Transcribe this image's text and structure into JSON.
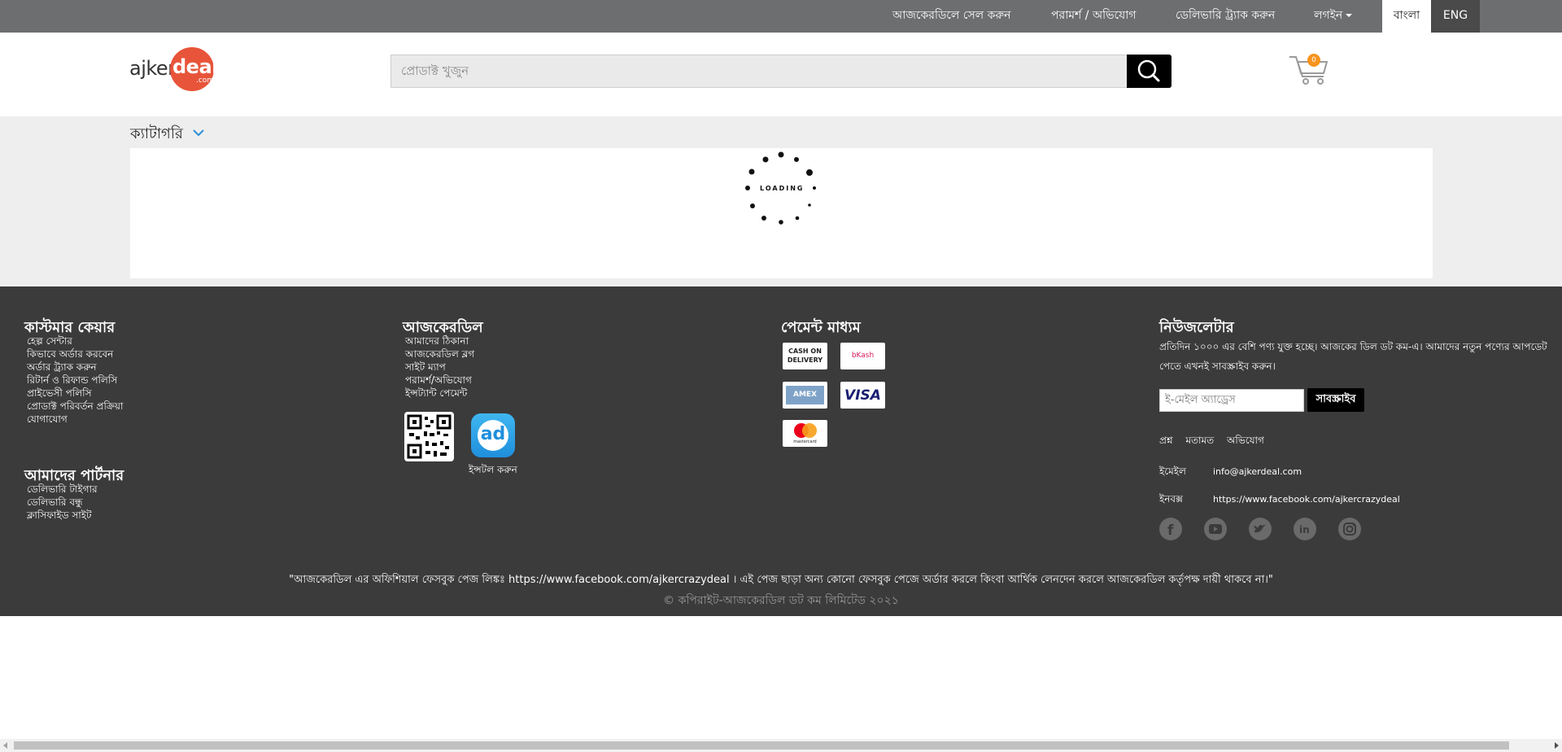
{
  "topbar": {
    "sell": "আজকেরডিলে সেল করুন",
    "feedback": "পরামর্শ / অভিযোগ",
    "track": "ডেলিভারি ট্র্যাক করুন",
    "login": "লগইন",
    "lang_bn": "বাংলা",
    "lang_en": "ENG"
  },
  "header": {
    "logo_ajker": "ajker",
    "logo_deal": "deal",
    "logo_com": ".com",
    "search_placeholder": "প্রোডাক্ট খুজুন",
    "cart_count": "0"
  },
  "category": {
    "label": "ক্যাটাগরি",
    "loading": "LOADING"
  },
  "footer": {
    "customer_care": {
      "title": "কাস্টমার কেয়ার",
      "items": [
        "হেল্প সেন্টার",
        "কিভাবে অর্ডার করবেন",
        "অর্ডার ট্র্যাক করুন",
        "রিটার্ন ও রিফান্ড পলিসি",
        "প্রাইভেসী পলিসি",
        "প্রোডাক্ট পরিবর্তন প্রক্রিয়া",
        "যোগাযোগ"
      ]
    },
    "partners": {
      "title": "আমাদের পার্টনার",
      "items": [
        "ডেলিভারি টাইগার",
        "ডেলিভারি বন্ধু",
        "ক্লাসিফাইড সাইট"
      ]
    },
    "ajkerdeal": {
      "title": "আজকেরডিল",
      "items": [
        "আমাদের ঠিকানা",
        "আজকেরডিল ব্লগ",
        "সাইট ম্যাপ",
        "পরামর্শ/অভিযোগ",
        "ইন্সট্যান্ট পেমেন্ট"
      ],
      "app_caption": "ইন্সটল করুন",
      "app_icon_text": "ad"
    },
    "payment": {
      "title": "পেমেন্ট মাধ্যম",
      "cod": "CASH ON DELIVERY",
      "bkash": "bKash",
      "amex": "AMEX",
      "visa": "VISA",
      "mastercard": "mastercard"
    },
    "newsletter": {
      "title": "নিউজলেটার",
      "description": "প্রতিদিন ১০০০ এর বেশি পণ্য যুক্ত হচ্ছে। আজকের ডিল ডট কম-এ। আমাদের নতুন পণ্যের আপডেট পেতে এখনই সাবস্ক্রাইব করুন।",
      "email_placeholder": "ই-মেইল অ্যাড্রেস",
      "subscribe": "সাবস্ক্রাইব",
      "links": [
        "প্রশ্ন",
        "মতামত",
        "অভিযোগ"
      ],
      "email_label": "ইমেইল",
      "email_value": "info@ajkerdeal.com",
      "inbox_label": "ইনবক্স",
      "inbox_value": "https://www.facebook.com/ajkercrazydeal"
    },
    "disclaimer": "\"আজকেরডিল এর অফিশিয়াল ফেসবুক পেজ লিঙ্কঃ https://www.facebook.com/ajkercrazydeal । এই পেজ ছাড়া অন্য কোনো ফেসবুক পেজে অর্ডার করলে কিংবা আর্থিক লেনদেন করলে আজকেরডিল কর্তৃপক্ষ দায়ী থাকবে না।\"",
    "copyright": "© কপিরাইট-আজকেরডিল ডট কম লিমিটেড ২০২১"
  },
  "colors": {
    "topbar": "#6d6e70",
    "footer": "#3b3b3c",
    "accent_orange": "#e8543a",
    "cart_badge": "#f7941d"
  }
}
